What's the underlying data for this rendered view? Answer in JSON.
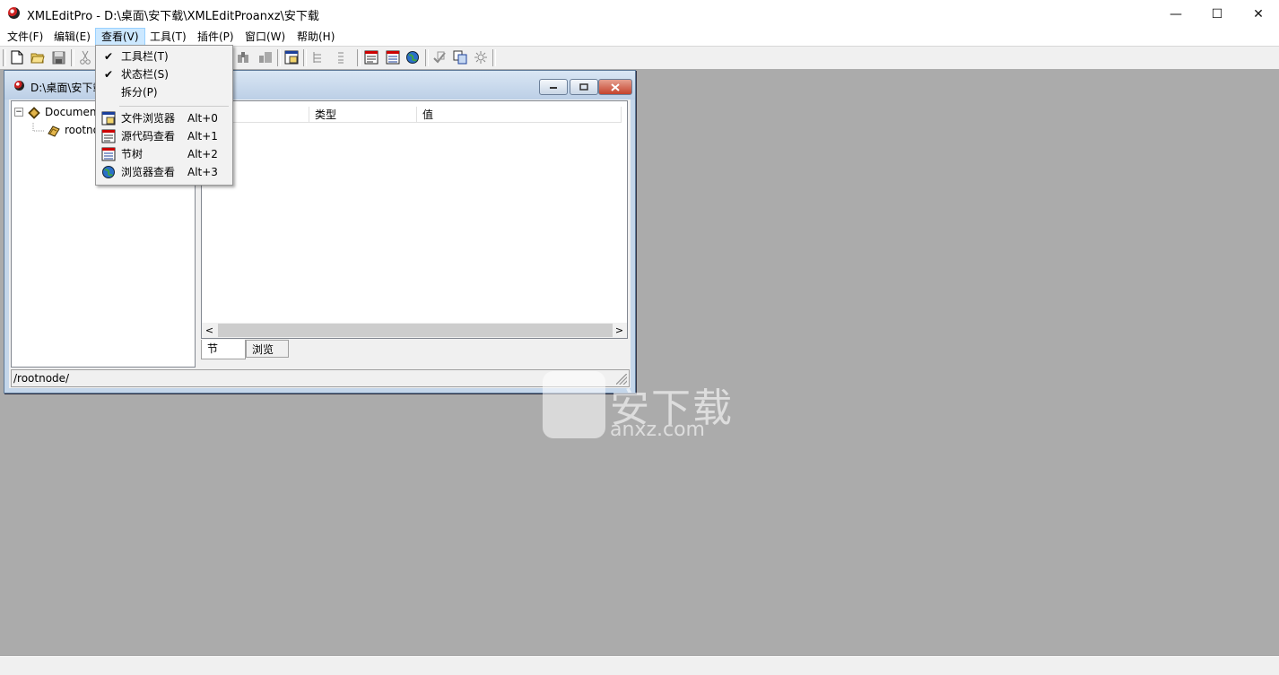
{
  "window": {
    "title": "XMLEditPro - D:\\桌面\\安下载\\XMLEditProanxz\\安下载",
    "minimize_glyph": "—",
    "maximize_glyph": "☐",
    "close_glyph": "✕"
  },
  "menubar": {
    "items": [
      {
        "label": "文件(F)"
      },
      {
        "label": "编辑(E)"
      },
      {
        "label": "查看(V)"
      },
      {
        "label": "工具(T)"
      },
      {
        "label": "插件(P)"
      },
      {
        "label": "窗口(W)"
      },
      {
        "label": "帮助(H)"
      }
    ],
    "active_index": 2
  },
  "toolbar": {
    "buttons": [
      "new-icon",
      "open-icon",
      "save-icon",
      "cut-icon",
      "find-icon",
      "replace-icon",
      "file-browser-icon",
      "tree-icon",
      "list-icon",
      "source-view-icon",
      "section-tree-icon",
      "browser-icon",
      "validate-icon",
      "copy-icon",
      "plugin-icon"
    ]
  },
  "view_menu": {
    "items": [
      {
        "label": "工具栏(T)",
        "checked": true,
        "accel": ""
      },
      {
        "label": "状态栏(S)",
        "checked": true,
        "accel": ""
      },
      {
        "label": "拆分(P)",
        "checked": false,
        "accel": ""
      },
      {
        "label": "文件浏览器",
        "icon": "file-browser-icon",
        "accel": "Alt+0"
      },
      {
        "label": "源代码查看",
        "icon": "source-view-icon",
        "accel": "Alt+1"
      },
      {
        "label": "节树",
        "icon": "section-tree-icon",
        "accel": "Alt+2"
      },
      {
        "label": "浏览器查看",
        "icon": "globe-icon",
        "accel": "Alt+3"
      }
    ],
    "check_glyph": "✔"
  },
  "child_window": {
    "title": "D:\\桌面\\安下载",
    "tree": {
      "root_label": "Documen",
      "child_label": "rootno"
    },
    "list": {
      "columns": [
        "",
        "类型",
        "值"
      ]
    },
    "tabs": [
      "节",
      "浏览"
    ],
    "selected_tab": 0,
    "status_path": "/rootnode/"
  },
  "watermark": {
    "text": "安下载",
    "domain": "anxz.com"
  }
}
